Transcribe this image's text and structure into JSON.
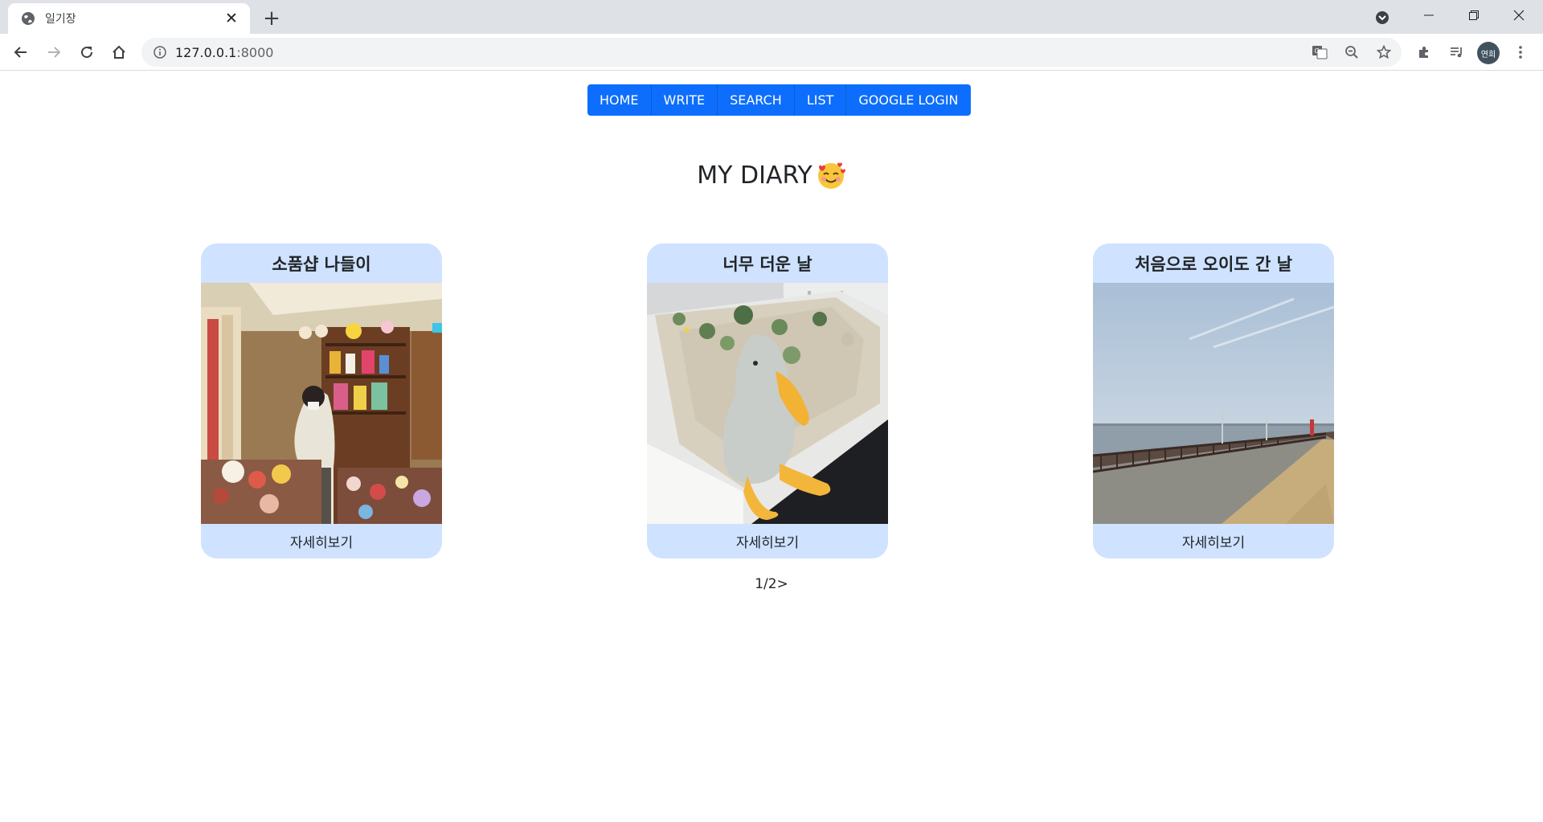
{
  "browser": {
    "tab_title": "일기장",
    "url_host": "127.0.0.1",
    "url_port": ":8000",
    "profile_initials": "연희",
    "icons": [
      "globe-icon",
      "close-icon",
      "plus-icon",
      "tab-search-icon",
      "minimize-icon",
      "restore-icon",
      "window-close-icon",
      "back-icon",
      "forward-icon",
      "reload-icon",
      "home-icon",
      "info-icon",
      "translate-icon",
      "zoom-out-icon",
      "star-icon",
      "extensions-icon",
      "reading-list-icon",
      "menu-icon"
    ]
  },
  "nav": {
    "items": [
      "HOME",
      "WRITE",
      "SEARCH",
      "LIST",
      "GOOGLE LOGIN"
    ],
    "color": "#0d6efd"
  },
  "page": {
    "title": "MY DIARY",
    "title_emoji": "smiling-face-with-hearts"
  },
  "cards": [
    {
      "title": "소품샵 나들이",
      "link": "자세히보기",
      "image": "store-photo"
    },
    {
      "title": "너무 더운 날",
      "link": "자세히보기",
      "image": "duck-plush-photo"
    },
    {
      "title": "처음으로 오이도 간 날",
      "link": "자세히보기",
      "image": "seaside-promenade-photo"
    }
  ],
  "card_color": "#cfe2ff",
  "pagination": "1/2>"
}
